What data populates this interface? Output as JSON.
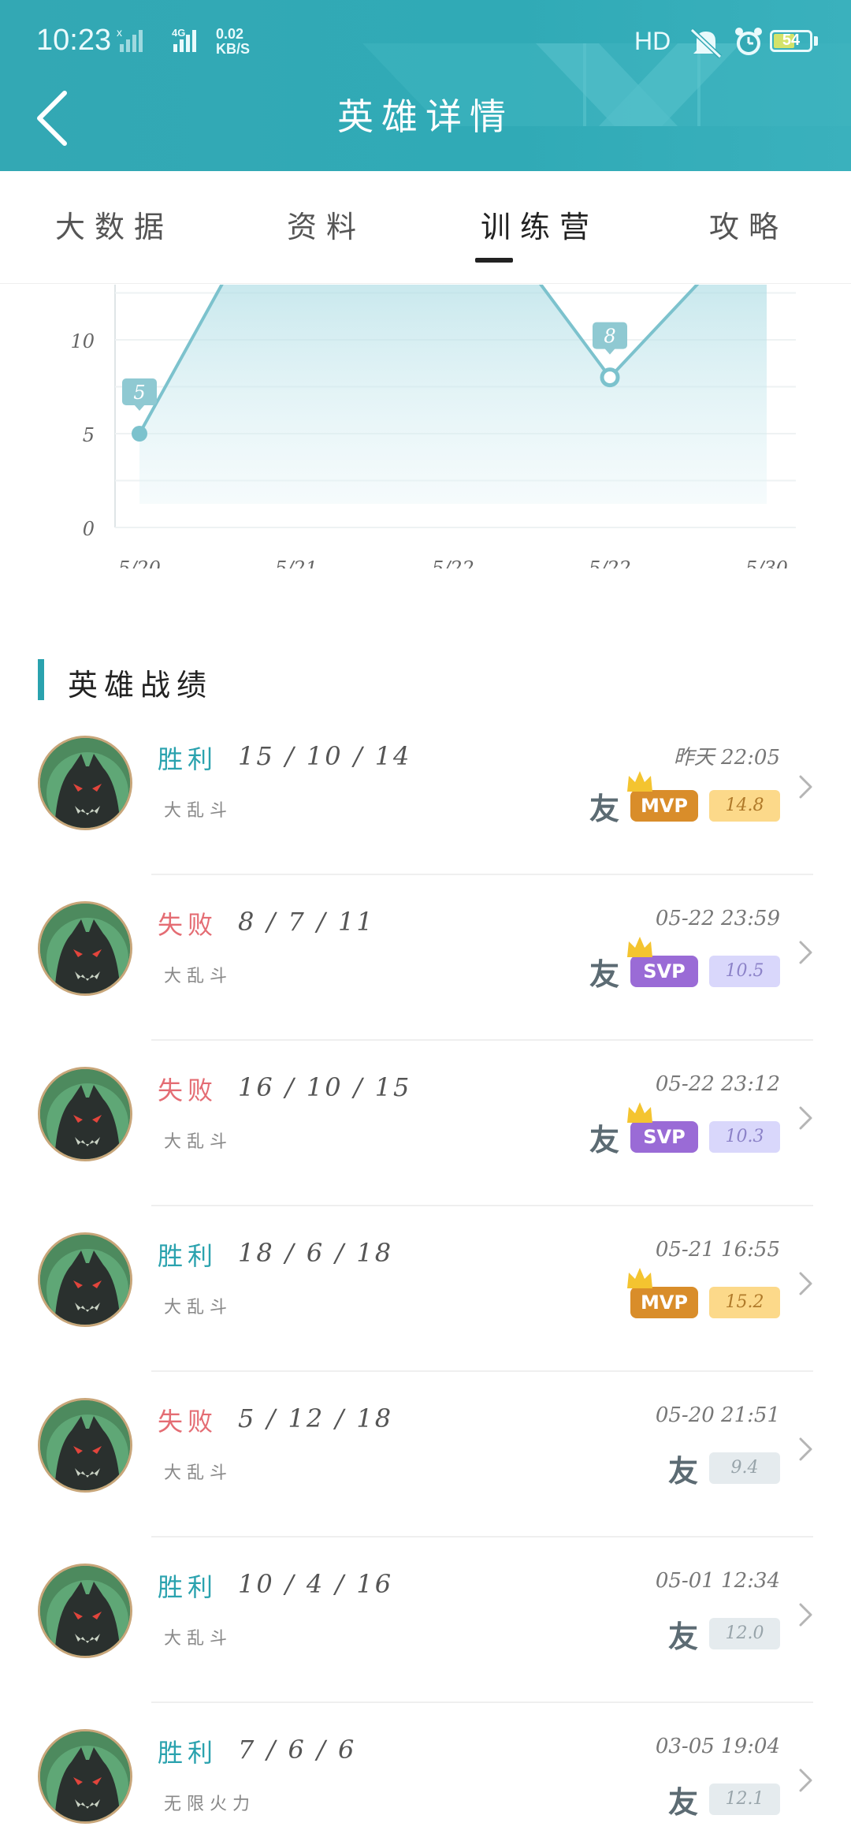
{
  "status_bar": {
    "time": "10:23",
    "network": "4G",
    "speed_value": "0.02",
    "speed_unit": "KB/S",
    "hd": "HD",
    "battery": "54"
  },
  "header": {
    "title": "英雄详情",
    "background_color": "#33a8b4"
  },
  "tabs": [
    {
      "label": "大数据",
      "active": false
    },
    {
      "label": "资料",
      "active": false
    },
    {
      "label": "训练营",
      "active": true
    },
    {
      "label": "攻略",
      "active": false
    }
  ],
  "chart_data": {
    "type": "area",
    "categories": [
      "5/20",
      "5/21",
      "5/22",
      "5/22",
      "5/30"
    ],
    "values": [
      5,
      null,
      null,
      8,
      null
    ],
    "point_labels": [
      "5",
      "8"
    ],
    "y_ticks": [
      "0",
      "5",
      "10"
    ],
    "ylim": [
      0,
      10
    ],
    "grid": true,
    "line_color": "#7cc2cd"
  },
  "section": {
    "title": "英雄战绩"
  },
  "matches": [
    {
      "result": "胜利",
      "outcome": "win",
      "kda": "15 / 10 / 14",
      "time": "昨天 22:05",
      "mode": "大乱斗",
      "friend": "友",
      "award": "MVP",
      "award_type": "mvp",
      "score": "14.8",
      "score_style": "gold"
    },
    {
      "result": "失败",
      "outcome": "lose",
      "kda": "8 / 7 / 11",
      "time": "05-22 23:59",
      "mode": "大乱斗",
      "friend": "友",
      "award": "SVP",
      "award_type": "svp",
      "score": "10.5",
      "score_style": "violet"
    },
    {
      "result": "失败",
      "outcome": "lose",
      "kda": "16 / 10 / 15",
      "time": "05-22 23:12",
      "mode": "大乱斗",
      "friend": "友",
      "award": "SVP",
      "award_type": "svp",
      "score": "10.3",
      "score_style": "violet"
    },
    {
      "result": "胜利",
      "outcome": "win",
      "kda": "18 / 6 / 18",
      "time": "05-21 16:55",
      "mode": "大乱斗",
      "friend": "",
      "award": "MVP",
      "award_type": "mvp",
      "score": "15.2",
      "score_style": "gold"
    },
    {
      "result": "失败",
      "outcome": "lose",
      "kda": "5 / 12 / 18",
      "time": "05-20 21:51",
      "mode": "大乱斗",
      "friend": "友",
      "award": "",
      "award_type": "",
      "score": "9.4",
      "score_style": "grey"
    },
    {
      "result": "胜利",
      "outcome": "win",
      "kda": "10 / 4 / 16",
      "time": "05-01 12:34",
      "mode": "大乱斗",
      "friend": "友",
      "award": "",
      "award_type": "",
      "score": "12.0",
      "score_style": "grey"
    },
    {
      "result": "胜利",
      "outcome": "win",
      "kda": "7 / 6 / 6",
      "time": "03-05 19:04",
      "mode": "无限火力",
      "friend": "友",
      "award": "",
      "award_type": "",
      "score": "12.1",
      "score_style": "grey"
    }
  ]
}
